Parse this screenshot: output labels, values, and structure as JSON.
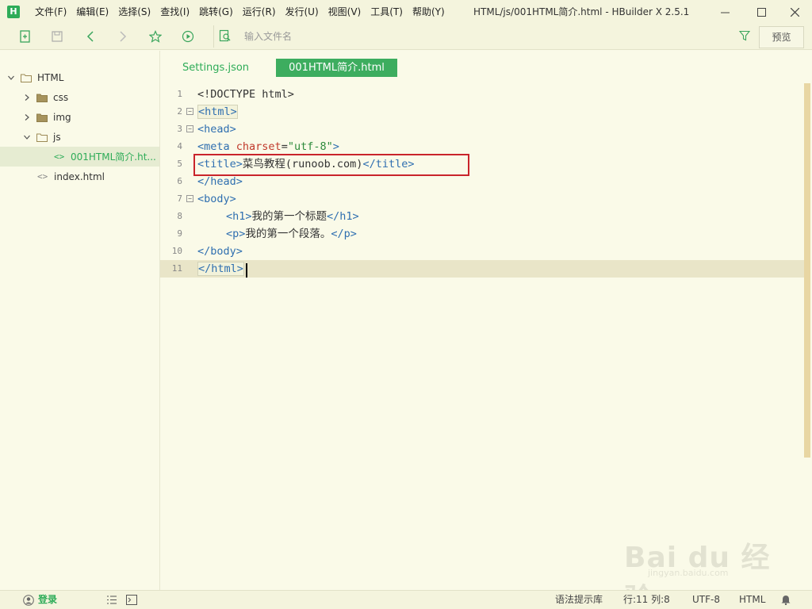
{
  "app": {
    "logo_letter": "H",
    "window_title": "HTML/js/001HTML简介.html - HBuilder X 2.5.1",
    "menu": [
      "文件(F)",
      "编辑(E)",
      "选择(S)",
      "查找(I)",
      "跳转(G)",
      "运行(R)",
      "发行(U)",
      "视图(V)",
      "工具(T)",
      "帮助(Y)"
    ],
    "accent_color": "#2eac58"
  },
  "toolbar": {
    "search_placeholder": "输入文件名",
    "preview_label": "预览",
    "icons": [
      "new-file-icon",
      "save-icon",
      "back-icon",
      "forward-icon",
      "star-icon",
      "run-icon",
      "file-search-icon",
      "filter-icon"
    ]
  },
  "sidebar": {
    "tree": [
      {
        "label": "HTML",
        "type": "folder",
        "expanded": true
      },
      {
        "label": "css",
        "type": "folder",
        "expanded": false
      },
      {
        "label": "img",
        "type": "folder",
        "expanded": false
      },
      {
        "label": "js",
        "type": "folder",
        "expanded": true
      },
      {
        "label": "001HTML简介.ht...",
        "type": "file",
        "selected": true
      },
      {
        "label": "index.html",
        "type": "file"
      }
    ]
  },
  "tabs": [
    {
      "label": "Settings.json",
      "active": false
    },
    {
      "label": "001HTML简介.html",
      "active": true
    }
  ],
  "editor": {
    "line_numbers": [
      "1",
      "2",
      "3",
      "4",
      "5",
      "6",
      "7",
      "8",
      "9",
      "10",
      "11"
    ],
    "lines": {
      "l1": "<!DOCTYPE html>",
      "l2_tag": "<html>",
      "l3_tag": "<head>",
      "l4_open": "<meta ",
      "l4_attr": "charset",
      "l4_eq": "=",
      "l4_val": "\"utf-8\"",
      "l4_close": ">",
      "l5_open": "<title>",
      "l5_text": "菜鸟教程(runoob.com)",
      "l5_close": "</title>",
      "l6_tag": "</head>",
      "l7_tag": "<body>",
      "l8_open": "<h1>",
      "l8_text": "我的第一个标题",
      "l8_close": "</h1>",
      "l9_open": "<p>",
      "l9_text": "我的第一个段落。",
      "l9_close": "</p>",
      "l10_tag": "</body>",
      "l11_tag": "</html>"
    },
    "current_line": 11
  },
  "statusbar": {
    "login": "登录",
    "syntax_hint": "语法提示库",
    "position": "行:11  列:8",
    "encoding": "UTF-8",
    "language": "HTML"
  },
  "watermark": {
    "text": "Bai du 经验",
    "url": "jingyan.baidu.com"
  }
}
